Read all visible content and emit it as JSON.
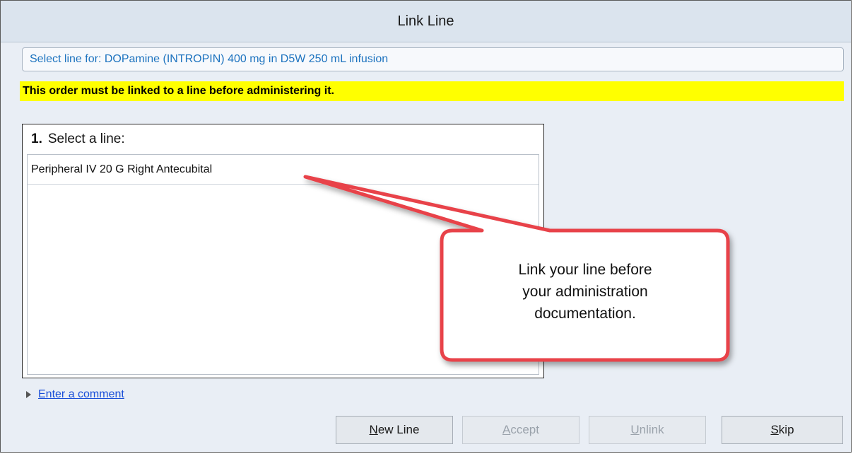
{
  "window": {
    "title": "Link Line"
  },
  "header": {
    "select_for": "Select line for: DOPamine (INTROPIN) 400 mg in D5W 250 mL infusion"
  },
  "warning": {
    "text": "This order must be linked to a line before administering it."
  },
  "panel": {
    "step_number": "1.",
    "heading": "Select a line:",
    "lines": [
      {
        "label": "Peripheral IV 20 G Right Antecubital"
      }
    ]
  },
  "comment": {
    "link_text": "Enter a comment"
  },
  "buttons": {
    "new_line": "New Line",
    "accept": "Accept",
    "unlink": "Unlink",
    "skip": "Skip"
  },
  "callout": {
    "lines": [
      "Link your line before",
      "your administration",
      "documentation."
    ],
    "border_color": "#e8434a"
  },
  "colors": {
    "warning": "#ffff00",
    "link": "#1a4fd8",
    "header_text": "#1d73bf"
  },
  "icons": {
    "expand": "triangle-right-icon"
  }
}
